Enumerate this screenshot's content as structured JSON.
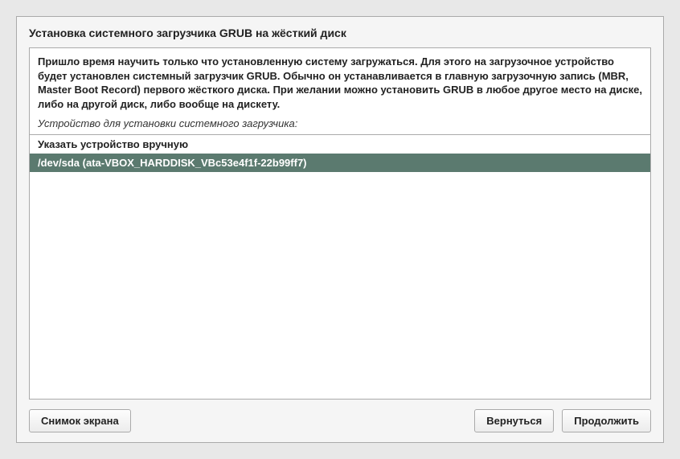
{
  "title": "Установка системного загрузчика GRUB на жёсткий диск",
  "description": "Пришло время научить только что установленную систему загружаться. Для этого на загрузочное устройство будет установлен системный загрузчик GRUB. Обычно он устанавливается в главную загрузочную запись (MBR, Master Boot Record) первого жёсткого диска. При желании можно установить GRUB в любое другое место на диске, либо на другой диск, либо вообще на дискету.",
  "subtitle": "Устройство для установки системного загрузчика:",
  "devices": {
    "manual": "Указать устройство вручную",
    "selected": "/dev/sda  (ata-VBOX_HARDDISK_VBc53e4f1f-22b99ff7)"
  },
  "buttons": {
    "screenshot": "Снимок экрана",
    "back": "Вернуться",
    "continue": "Продолжить"
  }
}
